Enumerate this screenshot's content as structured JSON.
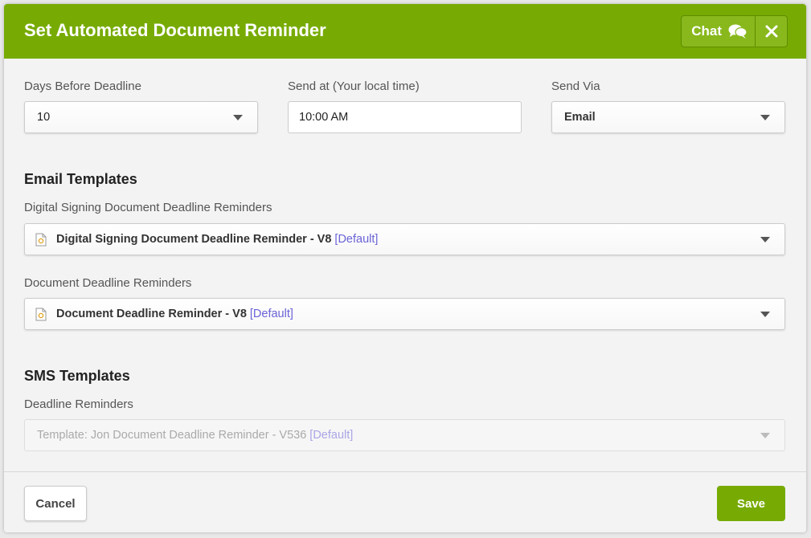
{
  "modal": {
    "title": "Set Automated Document Reminder",
    "chat_label": "Chat",
    "accent_color": "#77ab04"
  },
  "settings": {
    "days_label": "Days Before Deadline",
    "days_value": "10",
    "send_at_label": "Send at (Your local time)",
    "send_at_value": "10:00 AM",
    "send_via_label": "Send Via",
    "send_via_value": "Email"
  },
  "email_templates": {
    "heading": "Email Templates",
    "digital_label": "Digital Signing Document Deadline Reminders",
    "digital_value": "Digital Signing Document Deadline Reminder - V8",
    "digital_tag": "[Default]",
    "document_label": "Document Deadline Reminders",
    "document_value": "Document Deadline Reminder - V8",
    "document_tag": "[Default]"
  },
  "sms_templates": {
    "heading": "SMS Templates",
    "deadline_label": "Deadline Reminders",
    "deadline_value": "Template: Jon Document Deadline Reminder - V536",
    "deadline_tag": "[Default]"
  },
  "footer": {
    "cancel_label": "Cancel",
    "save_label": "Save"
  },
  "icons": {
    "chat": "chat-bubbles-icon",
    "close": "close-icon",
    "template": "document-icon",
    "dropdown": "caret-down-icon"
  }
}
